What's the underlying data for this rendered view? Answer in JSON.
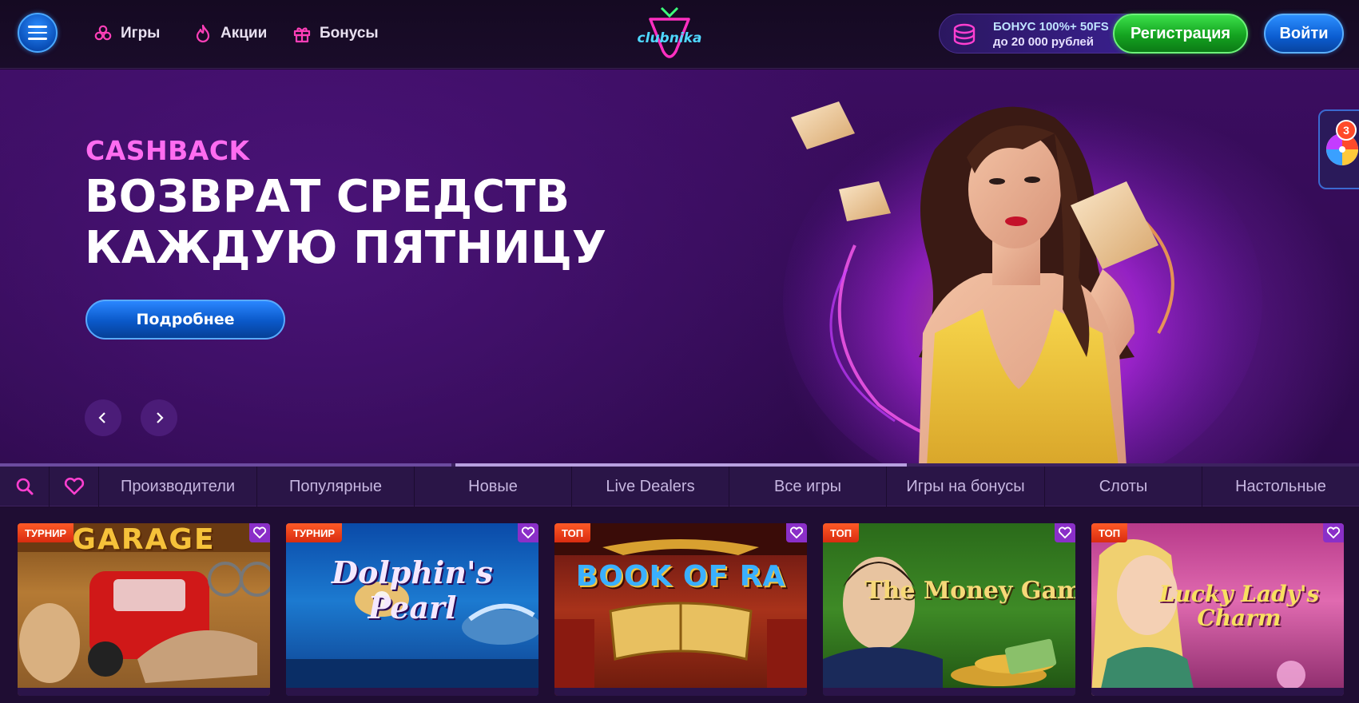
{
  "header": {
    "nav": [
      {
        "label": "Игры",
        "icon": "clover-icon"
      },
      {
        "label": "Акции",
        "icon": "flame-icon"
      },
      {
        "label": "Бонусы",
        "icon": "gift-icon"
      }
    ],
    "logo_text": "clubnika",
    "bonus": {
      "line1": "БОНУС 100%+ 50FS",
      "line2": "до 20 000 рублей",
      "icon": "coins-icon"
    },
    "register_label": "Регистрация",
    "login_label": "Войти",
    "colors": {
      "register": "#14a320",
      "login": "#0b5cd0",
      "accent": "#ff6cf0"
    }
  },
  "hero": {
    "tag": "CASHBACK",
    "title_line1": "ВОЗВРАТ СРЕДСТВ",
    "title_line2": "КАЖДУЮ ПЯТНИЦУ",
    "button_label": "Подробнее",
    "slider_progress": 0.67
  },
  "wheel_widget": {
    "badge_count": "3",
    "icon": "fortune-wheel-icon"
  },
  "categories": [
    "Производители",
    "Популярные",
    "Новые",
    "Live Dealers",
    "Все игры",
    "Игры на бонусы",
    "Слоты",
    "Настольные"
  ],
  "games": [
    {
      "badge": "ТУРНИР",
      "title": "GARAGE"
    },
    {
      "badge": "ТУРНИР",
      "title": "Dolphin's Pearl"
    },
    {
      "badge": "ТОП",
      "title": "BOOK OF RA"
    },
    {
      "badge": "ТОП",
      "title": "The Money Game"
    },
    {
      "badge": "ТОП",
      "title": "Lucky Lady's Charm"
    }
  ]
}
